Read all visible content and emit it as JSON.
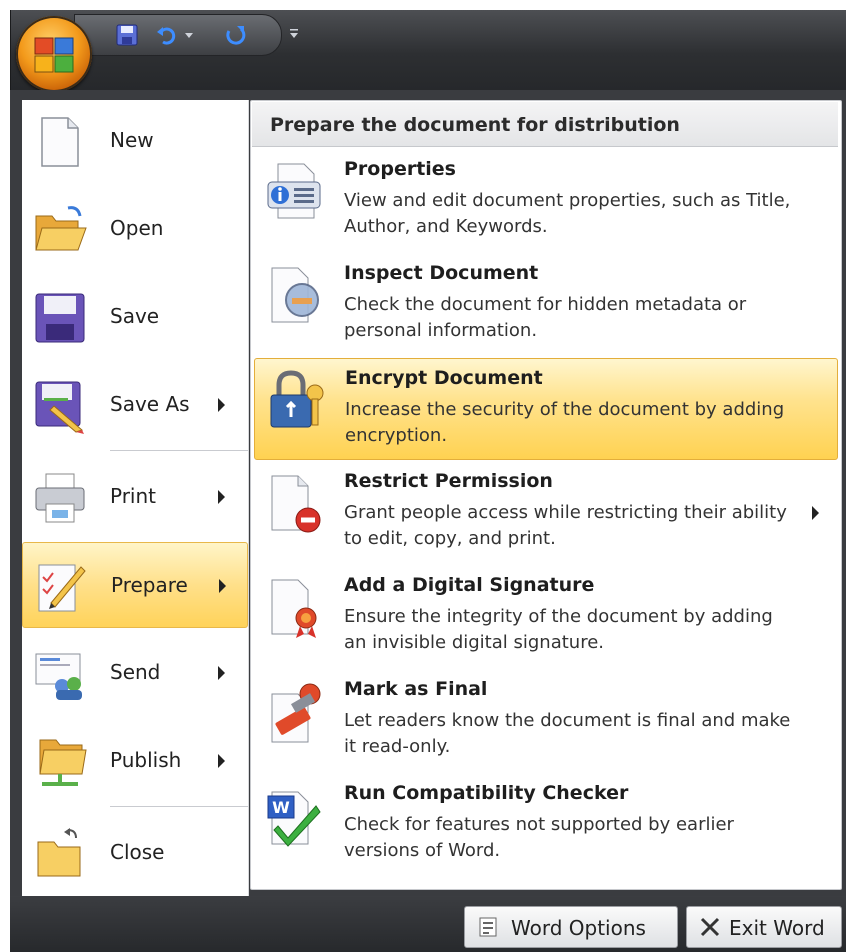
{
  "quick_access": {
    "save_icon": "save-icon",
    "undo_icon": "undo-icon",
    "redo_icon": "redo-icon",
    "customize_icon": "customize-qat-icon"
  },
  "left_menu": {
    "items": [
      {
        "label": "New",
        "icon": "new-document-icon",
        "submenu": false
      },
      {
        "label": "Open",
        "icon": "open-folder-icon",
        "submenu": false
      },
      {
        "label": "Save",
        "icon": "save-disk-icon",
        "submenu": false
      },
      {
        "label": "Save As",
        "icon": "save-as-icon",
        "submenu": true
      },
      {
        "label": "Print",
        "icon": "printer-icon",
        "submenu": true
      },
      {
        "label": "Prepare",
        "icon": "prepare-icon",
        "submenu": true,
        "active": true
      },
      {
        "label": "Send",
        "icon": "send-icon",
        "submenu": true
      },
      {
        "label": "Publish",
        "icon": "publish-icon",
        "submenu": true
      },
      {
        "label": "Close",
        "icon": "close-folder-icon",
        "submenu": false
      }
    ]
  },
  "submenu": {
    "header": "Prepare the document for distribution",
    "items": [
      {
        "title": "Properties",
        "description": "View and edit document properties, such as Title, Author, and Keywords.",
        "icon": "properties-icon"
      },
      {
        "title": "Inspect Document",
        "description": "Check the document for hidden metadata or personal information.",
        "icon": "inspect-document-icon"
      },
      {
        "title": "Encrypt Document",
        "description": "Increase the security of the document by adding encryption.",
        "icon": "encrypt-lock-icon",
        "highlighted": true
      },
      {
        "title": "Restrict Permission",
        "description": "Grant people access while restricting their ability to edit, copy, and print.",
        "icon": "restrict-permission-icon",
        "submenu": true
      },
      {
        "title": "Add a Digital Signature",
        "description": "Ensure the integrity of the document by adding an invisible digital signature.",
        "icon": "digital-signature-icon"
      },
      {
        "title": "Mark as Final",
        "description": "Let readers know the document is final and make it read-only.",
        "icon": "mark-final-icon"
      },
      {
        "title": "Run Compatibility Checker",
        "description": "Check for features not supported by earlier versions of Word.",
        "icon": "compatibility-checker-icon"
      }
    ]
  },
  "footer": {
    "word_options": "Word Options",
    "exit_word": "Exit Word"
  },
  "colors": {
    "highlight": "#ffd251",
    "accent_orange": "#f39a1b",
    "dark_chrome": "#2d2f32"
  }
}
